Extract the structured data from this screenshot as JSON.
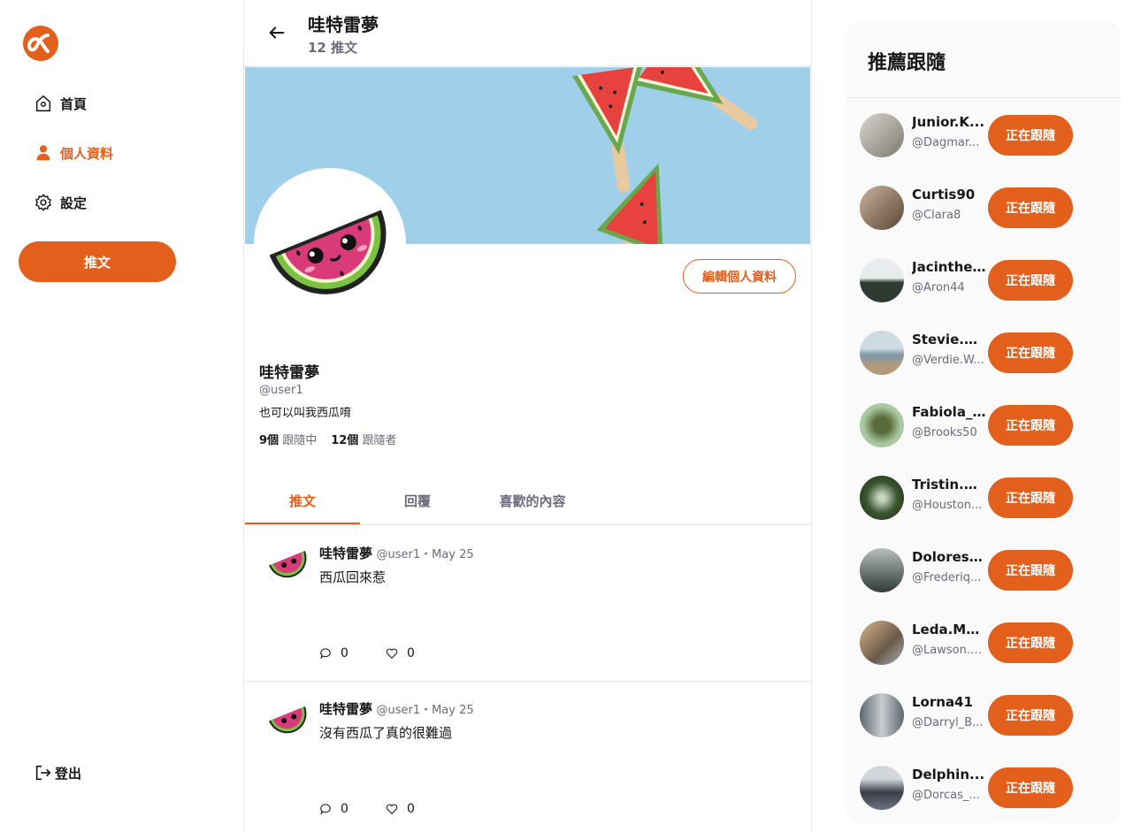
{
  "nav": {
    "items": [
      {
        "label": "首頁",
        "icon": "home-icon"
      },
      {
        "label": "個人資料",
        "icon": "user-icon"
      },
      {
        "label": "設定",
        "icon": "gear-icon"
      }
    ],
    "tweet_button": "推文",
    "logout": "登出"
  },
  "header": {
    "name": "哇特雷夢",
    "tweet_count": "12 推文"
  },
  "profile": {
    "edit_button": "編輯個人資料",
    "name": "哇特雷夢",
    "handle": "@user1",
    "bio": "也可以叫我西瓜唷",
    "following_count": "9個",
    "following_label": "跟隨中",
    "followers_count": "12個",
    "followers_label": "跟隨者"
  },
  "tabs": [
    "推文",
    "回覆",
    "喜歡的內容"
  ],
  "tweets": [
    {
      "name": "哇特雷夢",
      "meta": "@user1・May 25",
      "text": "西瓜回來惹",
      "replies": "0",
      "likes": "0"
    },
    {
      "name": "哇特雷夢",
      "meta": "@user1・May 25",
      "text": "沒有西瓜了真的很難過",
      "replies": "0",
      "likes": "0"
    }
  ],
  "sidebar": {
    "title": "推薦跟隨",
    "users": [
      {
        "name": "Junior.K...",
        "handle": "@Dagmar...",
        "button": "正在跟隨",
        "color": "#a7a49a"
      },
      {
        "name": "Curtis90",
        "handle": "@Clara8",
        "button": "正在跟隨",
        "color": "#8a6a55"
      },
      {
        "name": "Jacinthe...",
        "handle": "@Aron44",
        "button": "正在跟隨",
        "color": "#3f4a44"
      },
      {
        "name": "Stevie.M...",
        "handle": "@Verdie.W...",
        "button": "正在跟隨",
        "color": "#8ea6b5"
      },
      {
        "name": "Fabiola_...",
        "handle": "@Brooks50",
        "button": "正在跟隨",
        "color": "#8fb18a"
      },
      {
        "name": "Tristin.B...",
        "handle": "@Houston...",
        "button": "正在跟隨",
        "color": "#3e5a35"
      },
      {
        "name": "Dolores....",
        "handle": "@Frederiq...",
        "button": "正在跟隨",
        "color": "#3c4740"
      },
      {
        "name": "Leda.Mo...",
        "handle": "@Lawson.L...",
        "button": "正在跟隨",
        "color": "#9a7a5a"
      },
      {
        "name": "Lorna41",
        "handle": "@Darryl_B...",
        "button": "正在跟隨",
        "color": "#6f7880"
      },
      {
        "name": "Delphin...",
        "handle": "@Dorcas_...",
        "button": "正在跟隨",
        "color": "#4a4e5a"
      }
    ]
  },
  "colors": {
    "accent": "#e25f1c",
    "cover": "#9fcfe9"
  }
}
